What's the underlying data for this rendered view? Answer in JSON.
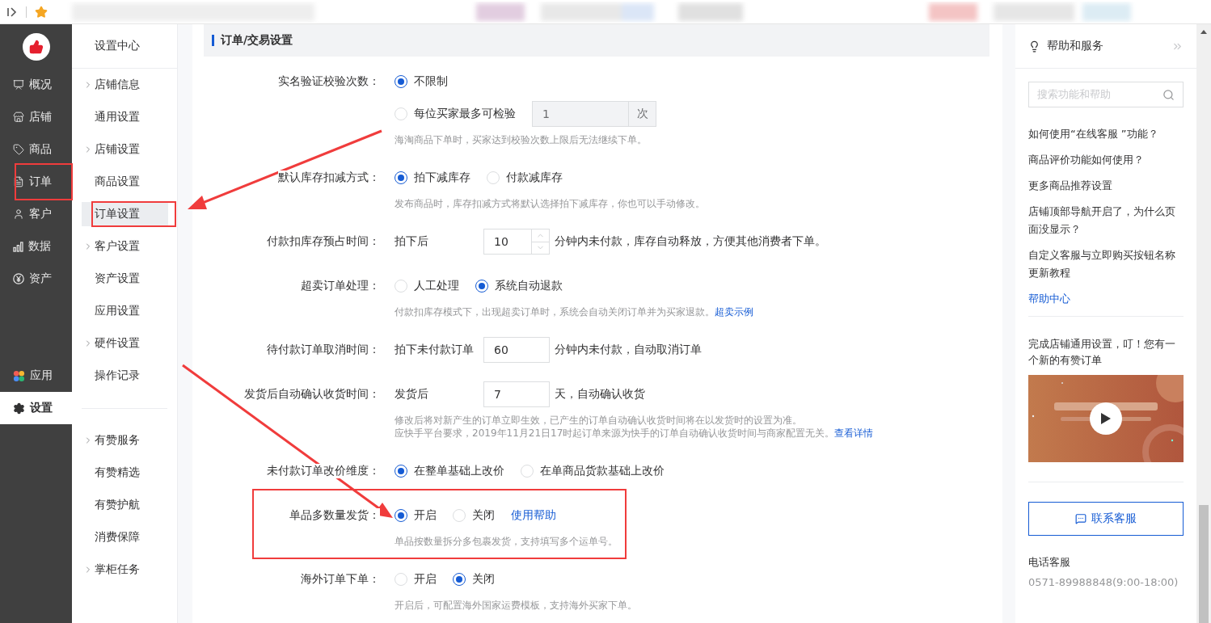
{
  "primary_nav": {
    "items": [
      {
        "label": "概况",
        "selected": false,
        "highlighted": false
      },
      {
        "label": "店铺",
        "selected": false,
        "highlighted": false
      },
      {
        "label": "商品",
        "selected": false,
        "highlighted": false
      },
      {
        "label": "订单",
        "selected": false,
        "highlighted": true
      },
      {
        "label": "客户",
        "selected": false,
        "highlighted": false
      },
      {
        "label": "数据",
        "selected": false,
        "highlighted": false
      },
      {
        "label": "资产",
        "selected": false,
        "highlighted": false
      }
    ],
    "bottom_items": [
      {
        "label": "应用",
        "selected": false
      },
      {
        "label": "设置",
        "selected": true
      }
    ]
  },
  "secondary_nav": {
    "title": "设置中心",
    "groups": [
      {
        "items": [
          {
            "label": "店铺信息",
            "expandable": true,
            "selected": false,
            "highlighted": false
          },
          {
            "label": "通用设置",
            "expandable": false,
            "selected": false,
            "highlighted": false
          },
          {
            "label": "店铺设置",
            "expandable": true,
            "selected": false,
            "highlighted": false
          },
          {
            "label": "商品设置",
            "expandable": false,
            "selected": false,
            "highlighted": false
          },
          {
            "label": "订单设置",
            "expandable": false,
            "selected": true,
            "highlighted": true
          },
          {
            "label": "客户设置",
            "expandable": true,
            "selected": false,
            "highlighted": false
          },
          {
            "label": "资产设置",
            "expandable": false,
            "selected": false,
            "highlighted": false
          },
          {
            "label": "应用设置",
            "expandable": false,
            "selected": false,
            "highlighted": false
          },
          {
            "label": "硬件设置",
            "expandable": true,
            "selected": false,
            "highlighted": false
          },
          {
            "label": "操作记录",
            "expandable": false,
            "selected": false,
            "highlighted": false
          }
        ]
      },
      {
        "items": [
          {
            "label": "有赞服务",
            "expandable": true,
            "selected": false,
            "highlighted": false
          },
          {
            "label": "有赞精选",
            "expandable": false,
            "selected": false,
            "highlighted": false
          },
          {
            "label": "有赞护航",
            "expandable": false,
            "selected": false,
            "highlighted": false
          },
          {
            "label": "消费保障",
            "expandable": false,
            "selected": false,
            "highlighted": false
          },
          {
            "label": "掌柜任务",
            "expandable": true,
            "selected": false,
            "highlighted": false
          }
        ]
      }
    ]
  },
  "section": {
    "title": "订单/交易设置",
    "rows": [
      {
        "label": "实名验证校验次数：",
        "highlighted": false,
        "lines": [
          [
            {
              "kind": "radio",
              "label": "不限制",
              "selected": true
            }
          ],
          [
            {
              "kind": "radio",
              "label": "每位买家最多可检验",
              "selected": false
            },
            {
              "kind": "input",
              "value": "1",
              "suffix": "次",
              "disabled": true
            }
          ]
        ],
        "hints": [
          {
            "text": "海淘商品下单时，买家达到校验次数上限后无法继续下单。"
          }
        ]
      },
      {
        "label": "默认库存扣减方式：",
        "highlighted": false,
        "lines": [
          [
            {
              "kind": "radio",
              "label": "拍下减库存",
              "selected": true
            },
            {
              "kind": "radio",
              "label": "付款减库存",
              "selected": false
            }
          ]
        ],
        "hints": [
          {
            "text": "发布商品时，库存扣减方式将默认选择拍下减库存，你也可以手动修改。"
          }
        ]
      },
      {
        "label": "付款扣库存预占时间：",
        "highlighted": false,
        "lines": [
          [
            {
              "kind": "text",
              "text": "拍下后"
            },
            {
              "kind": "stepper",
              "value": "10"
            },
            {
              "kind": "text",
              "text": "分钟内未付款，库存自动释放，方便其他消费者下单。"
            }
          ]
        ]
      },
      {
        "label": "超卖订单处理：",
        "highlighted": false,
        "lines": [
          [
            {
              "kind": "radio",
              "label": "人工处理",
              "selected": false
            },
            {
              "kind": "radio",
              "label": "系统自动退款",
              "selected": true
            }
          ]
        ],
        "hints": [
          {
            "text": "付款扣库存模式下，出现超卖订单时，系统会自动关闭订单并为买家退款。",
            "link": "超卖示例"
          }
        ]
      },
      {
        "label": "待付款订单取消时间：",
        "highlighted": false,
        "lines": [
          [
            {
              "kind": "text",
              "text": "拍下未付款订单"
            },
            {
              "kind": "input",
              "value": "60",
              "disabled": false
            },
            {
              "kind": "text",
              "text": "分钟内未付款，自动取消订单"
            }
          ]
        ]
      },
      {
        "label": "发货后自动确认收货时间：",
        "highlighted": false,
        "lines": [
          [
            {
              "kind": "text",
              "text": "发货后"
            },
            {
              "kind": "input",
              "value": "7",
              "disabled": false
            },
            {
              "kind": "text",
              "text": "天，自动确认收货"
            }
          ]
        ],
        "hints": [
          {
            "text": "修改后将对新产生的订单立即生效，已产生的订单自动确认收货时间将在以发货时的设置为准。"
          },
          {
            "text": "应快手平台要求，2019年11月21日17时起订单来源为快手的订单自动确认收货时间与商家配置无关。",
            "link": "查看详情"
          }
        ]
      },
      {
        "label": "未付款订单改价维度：",
        "highlighted": false,
        "lines": [
          [
            {
              "kind": "radio",
              "label": "在整单基础上改价",
              "selected": true
            },
            {
              "kind": "radio",
              "label": "在单商品货款基础上改价",
              "selected": false
            }
          ]
        ]
      },
      {
        "label": "单品多数量发货：",
        "highlighted": true,
        "lines": [
          [
            {
              "kind": "radio",
              "label": "开启",
              "selected": true
            },
            {
              "kind": "radio",
              "label": "关闭",
              "selected": false
            },
            {
              "kind": "link",
              "text": "使用帮助"
            }
          ]
        ],
        "hints": [
          {
            "text": "单品按数量拆分多包裹发货，支持填写多个运单号。"
          }
        ]
      },
      {
        "label": "海外订单下单：",
        "highlighted": false,
        "lines": [
          [
            {
              "kind": "radio",
              "label": "开启",
              "selected": false
            },
            {
              "kind": "radio",
              "label": "关闭",
              "selected": true
            }
          ]
        ],
        "hints": [
          {
            "text": "开启后，可配置海外国家运费模板，支持海外买家下单。"
          }
        ]
      }
    ]
  },
  "help_panel": {
    "title": "帮助和服务",
    "search": {
      "placeholder": "搜索功能和帮助"
    },
    "articles": [
      "如何使用“在线客服 ”功能？",
      "商品评价功能如何使用？",
      "更多商品推荐设置",
      "店铺顶部导航开启了，为什么页面没显示？",
      "自定义客服与立即购买按钮名称更新教程"
    ],
    "help_center": "帮助中心",
    "promo": {
      "text": "完成店铺通用设置，叮！您有一个新的有赞订单"
    },
    "contact_button": "联系客服",
    "phone_label": "电话客服",
    "phone": "0571-89988848(9:00-18:00)"
  }
}
